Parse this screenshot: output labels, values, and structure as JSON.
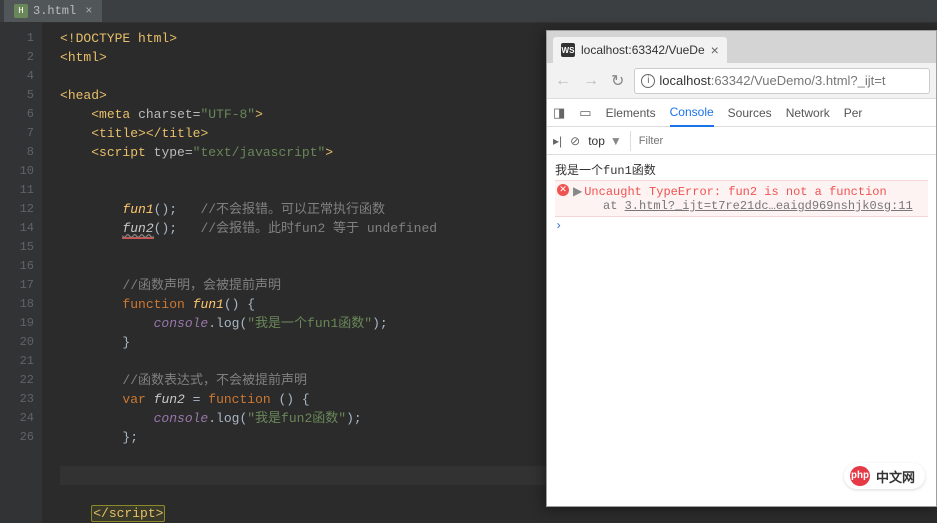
{
  "ide": {
    "tab": {
      "filename": "3.html"
    },
    "gutter": [
      "1",
      "2",
      "",
      "4",
      "5",
      "6",
      "7",
      "8",
      "",
      "10",
      "11",
      "12",
      "",
      "14",
      "15",
      "16",
      "17",
      "18",
      "19",
      "20",
      "21",
      "22",
      "23",
      "24",
      "",
      "26"
    ],
    "code": {
      "l1": {
        "doctype": "<!DOCTYPE html>"
      },
      "l2": {
        "open": "<",
        "tag": "html",
        "close": ">"
      },
      "l4": {
        "open": "<",
        "tag": "head",
        "close": ">"
      },
      "l5": {
        "open": "<",
        "tag": "meta",
        "sp": " ",
        "attr": "charset=",
        "val": "\"UTF-8\"",
        "close": ">"
      },
      "l6": {
        "o1": "<",
        "t1": "title",
        "c1": ">",
        "o2": "</",
        "t2": "title",
        "c2": ">"
      },
      "l7": {
        "open": "<",
        "tag": "script",
        "sp": " ",
        "attr": "type=",
        "val": "\"text/javascript\"",
        "close": ">"
      },
      "l10": {
        "fn": "fun1",
        "call": "();",
        "comment": "//不会报错。可以正常执行函数"
      },
      "l11": {
        "fn": "fun2",
        "call": "();",
        "comment": "//会报错。此时fun2 等于 undefined"
      },
      "l14": {
        "comment": "//函数声明，会被提前声明"
      },
      "l15": {
        "kw": "function ",
        "fn": "fun1",
        "rest": "() {"
      },
      "l16": {
        "obj": "console",
        "dot": ".log(",
        "str": "\"我是一个fun1函数\"",
        "end": ");"
      },
      "l17": {
        "brace": "}"
      },
      "l19": {
        "comment": "//函数表达式，不会被提前声明"
      },
      "l20": {
        "kw": "var ",
        "name": "fun2",
        "eq": " = ",
        "fnkw": "function ",
        "rest": "() {"
      },
      "l21": {
        "obj": "console",
        "dot": ".log(",
        "str": "\"我是fun2函数\"",
        "end": ");"
      },
      "l22": {
        "brace": "};"
      },
      "l26": {
        "open": "</",
        "tag": "script",
        "close": ">"
      }
    }
  },
  "browser": {
    "tab": {
      "title": "localhost:63342/VueDe"
    },
    "url": {
      "host": "localhost",
      "path": ":63342/VueDemo/3.html?_ijt=t"
    },
    "devtools": {
      "tabs": {
        "elements": "Elements",
        "console": "Console",
        "sources": "Sources",
        "network": "Network",
        "perf": "Per"
      },
      "context": "top",
      "filter_placeholder": "Filter"
    },
    "console": {
      "log1": "我是一个fun1函数",
      "error": "Uncaught TypeError: fun2 is not a function",
      "trace_prefix": "at ",
      "trace_link": "3.html?_ijt=t7re21dc…eaigd969nshjk0sg:11"
    }
  },
  "watermark": {
    "logo": "php",
    "text": "中文网"
  }
}
